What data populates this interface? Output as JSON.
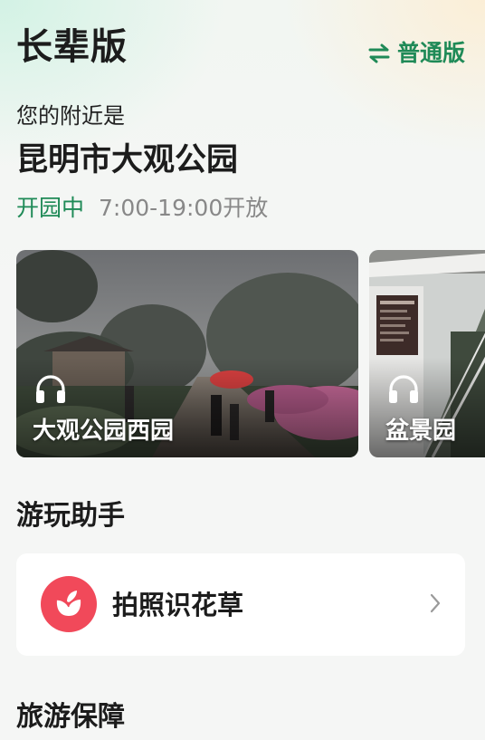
{
  "header": {
    "title": "长辈版",
    "mode_switch_label": "普通版"
  },
  "location": {
    "nearby_label": "您的附近是",
    "name": "昆明市大观公园",
    "status": "开园中",
    "hours": "7:00-19:00开放"
  },
  "audio_guides": [
    {
      "label": "大观公园西园",
      "icon": "headphones-icon"
    },
    {
      "label": "盆景园",
      "icon": "headphones-icon"
    }
  ],
  "assistant": {
    "section_title": "游玩助手",
    "items": [
      {
        "label": "拍照识花草",
        "icon": "flower-icon"
      }
    ]
  },
  "guarantee": {
    "section_title": "旅游保障"
  },
  "colors": {
    "accent_green": "#1f8a57",
    "flower_red": "#f1495a",
    "hours_gray": "#888888"
  }
}
